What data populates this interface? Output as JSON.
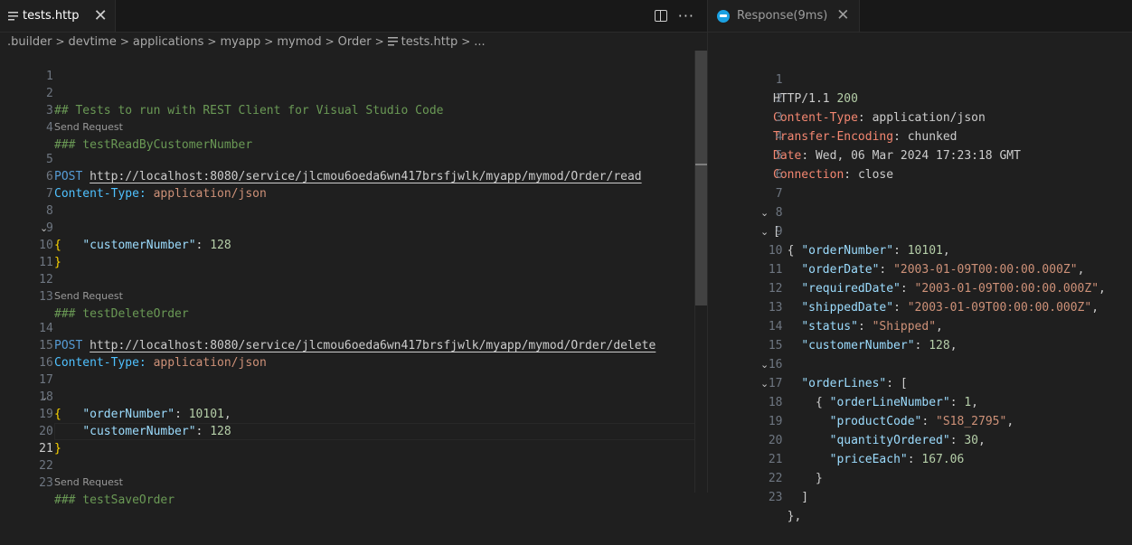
{
  "editor": {
    "tab_title": "tests.http",
    "close_glyph": "✕",
    "more_glyph": "···",
    "breadcrumb": [
      ".builder",
      "devtime",
      "applications",
      "myapp",
      "mymod",
      "Order"
    ],
    "breadcrumb_file": "tests.http",
    "breadcrumb_tail": "...",
    "codelens_label": "Send Request",
    "lines": {
      "l2": "## Tests to run with REST Client for Visual Studio Code",
      "l4": "### testReadByCustomerNumber",
      "l5_method": "POST",
      "l5_url": "http://localhost:8080/service/jlcmou6oeda6wn417brsfjwlk/myapp/mymod/Order/read",
      "l6_key": "Content-Type:",
      "l6_val": "application/json",
      "l8": "{",
      "l9_key": "\"customerNumber\"",
      "l9_num": "128",
      "l10": "}",
      "l13": "### testDeleteOrder",
      "l14_method": "POST",
      "l14_url": "http://localhost:8080/service/jlcmou6oeda6wn417brsfjwlk/myapp/mymod/Order/delete",
      "l15_key": "Content-Type:",
      "l15_val": "application/json",
      "l17": "{",
      "l18_key": "\"orderNumber\"",
      "l18_num": "10101",
      "l19_key": "\"customerNumber\"",
      "l19_num": "128",
      "l20": "}",
      "l23": "### testSaveOrder"
    },
    "line_numbers": [
      "1",
      "2",
      "3",
      "4",
      "5",
      "6",
      "7",
      "8",
      "9",
      "10",
      "11",
      "12",
      "13",
      "14",
      "15",
      "16",
      "17",
      "18",
      "19",
      "20",
      "21",
      "22",
      "23"
    ]
  },
  "response": {
    "tab_title": "Response(9ms)",
    "close_glyph": "✕",
    "line_numbers": [
      "1",
      "2",
      "3",
      "4",
      "5",
      "6",
      "7",
      "8",
      "9",
      "10",
      "11",
      "12",
      "13",
      "14",
      "15",
      "16",
      "17",
      "18",
      "19",
      "20",
      "21",
      "22",
      "23"
    ],
    "http_version": "HTTP/1.1",
    "status_code": "200",
    "headers": [
      {
        "key": "Content-Type",
        "value": "application/json"
      },
      {
        "key": "Transfer-Encoding",
        "value": "chunked"
      },
      {
        "key": "Date",
        "value": "Wed, 06 Mar 2024 17:23:18 GMT"
      },
      {
        "key": "Connection",
        "value": "close"
      }
    ],
    "body": {
      "orderNumber": {
        "key": "\"orderNumber\"",
        "value": "10101"
      },
      "orderDate": {
        "key": "\"orderDate\"",
        "value": "\"2003-01-09T00:00:00.000Z\""
      },
      "requiredDate": {
        "key": "\"requiredDate\"",
        "value": "\"2003-01-09T00:00:00.000Z\""
      },
      "shippedDate": {
        "key": "\"shippedDate\"",
        "value": "\"2003-01-09T00:00:00.000Z\""
      },
      "status": {
        "key": "\"status\"",
        "value": "\"Shipped\""
      },
      "customerNumber": {
        "key": "\"customerNumber\"",
        "value": "128"
      },
      "orderLines_key": "\"orderLines\"",
      "orderLineNumber": {
        "key": "\"orderLineNumber\"",
        "value": "1"
      },
      "productCode": {
        "key": "\"productCode\"",
        "value": "\"S18_2795\""
      },
      "quantityOrdered": {
        "key": "\"quantityOrdered\"",
        "value": "30"
      },
      "priceEach": {
        "key": "\"priceEach\"",
        "value": "167.06"
      }
    }
  }
}
